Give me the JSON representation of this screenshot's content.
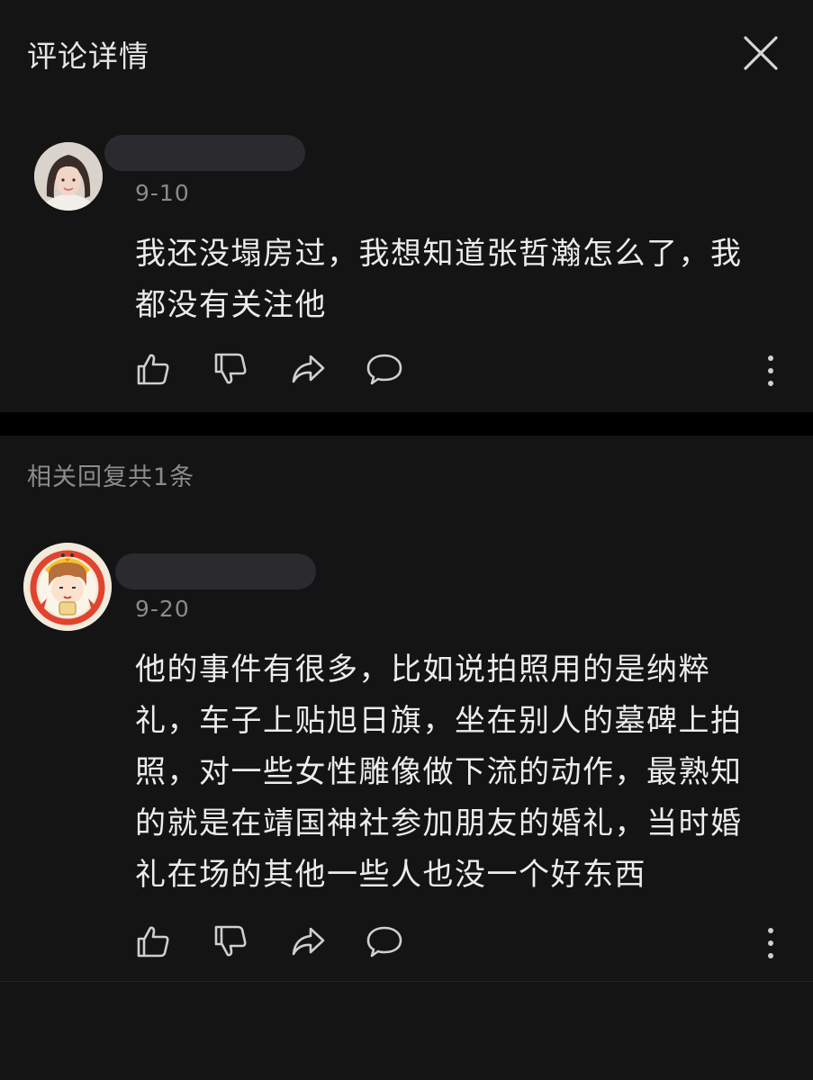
{
  "header": {
    "title": "评论详情",
    "close_icon": "close-icon"
  },
  "comment": {
    "date": "9-10",
    "text_line1": "我还没塌房过，我想知道张哲瀚怎么了，我",
    "text_line2": "都没有关注他",
    "actions": [
      "thumbs-up-icon",
      "thumbs-down-icon",
      "share-icon",
      "comment-icon",
      "more-icon"
    ]
  },
  "replies": {
    "count_label": "相关回复共1条"
  },
  "reply": {
    "date": "9-20",
    "lines": [
      "他的事件有很多，比如说拍照用的是纳粹",
      "礼，车子上贴旭日旗，坐在别人的墓碑上拍",
      "照，对一些女性雕像做下流的动作，最熟知",
      "的就是在靖国神社参加朋友的婚礼，当时婚",
      "礼在场的其他一些人也没一个好东西"
    ],
    "actions": [
      "thumbs-up-icon",
      "thumbs-down-icon",
      "share-icon",
      "comment-icon",
      "more-icon"
    ]
  },
  "colors": {
    "background": "#141414",
    "divider": "#000000",
    "text_primary": "#ececec",
    "text_secondary": "#8a8a8a",
    "redaction": "#2b2b2f"
  }
}
